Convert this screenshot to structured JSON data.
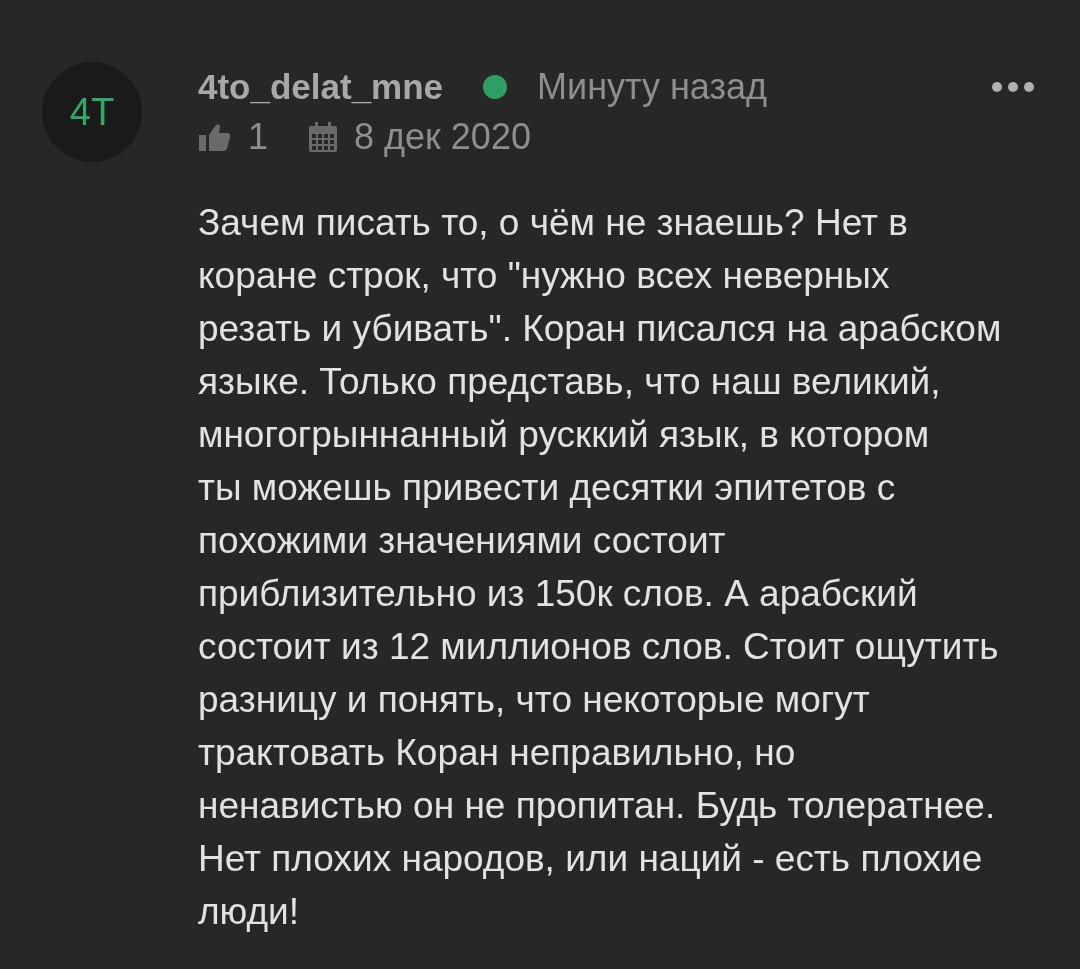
{
  "comment": {
    "avatar_initials": "4T",
    "author": "4to_delat_mne",
    "online": true,
    "time": "Минуту назад",
    "likes": "1",
    "date": "8 дек 2020",
    "body_lines": [
      "Зачем писать то, о чём не знаешь? Нет в",
      "коране строк, что \"нужно всех неверных",
      "резать и убивать\". Коран писался на арабском",
      "языке. Только представь, что наш великий,",
      "многогрыннанный русккий язык, в котором",
      "ты можешь привести десятки эпитетов с",
      "похожими значениями состоит",
      "приблизительно из 150к слов. А арабский",
      "состоит из 12 миллионов слов. Стоит ощутить",
      "разницу и понять, что некоторые могут",
      "трактовать Коран неправильно, но",
      "ненавистью он не пропитан. Будь толератнее.",
      "Нет плохих народов, или наций - есть плохие",
      "люди!"
    ]
  }
}
